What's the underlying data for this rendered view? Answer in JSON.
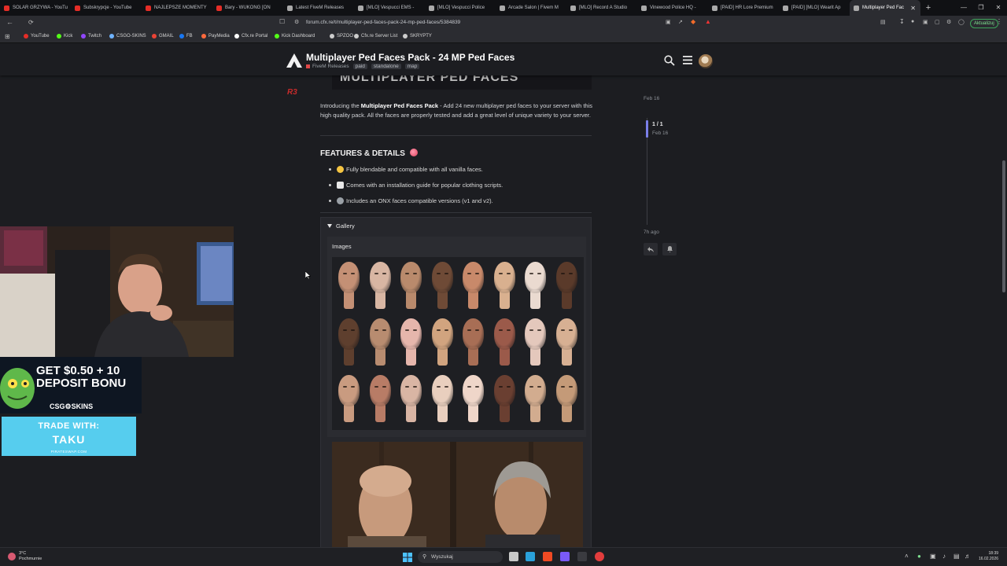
{
  "browser": {
    "tabs": [
      {
        "title": "SOLAR GRZYWA - YouTu",
        "color": "#e52d27"
      },
      {
        "title": "Subskrypcje - YouTube",
        "color": "#e52d27"
      },
      {
        "title": "NAJLEPSZE MOMENTY",
        "color": "#e52d27"
      },
      {
        "title": "Bary - WUKONG [ON",
        "color": "#e52d27"
      },
      {
        "title": "Latest FiveM Releases",
        "color": "#aaaaaa"
      },
      {
        "title": "[MLO] Vespucci EMS -",
        "color": "#aaaaaa"
      },
      {
        "title": "[MLO] Vespucci Police",
        "color": "#aaaaaa"
      },
      {
        "title": "Arcade Salon | Fivem M",
        "color": "#aaaaaa"
      },
      {
        "title": "[MLO] Record A Studio",
        "color": "#aaaaaa"
      },
      {
        "title": "Vinewood Police HQ - ",
        "color": "#aaaaaa"
      },
      {
        "title": "[PAID] HR Lore Premium",
        "color": "#aaaaaa"
      },
      {
        "title": "[PAID] [MLO] Wearit Ap",
        "color": "#aaaaaa"
      },
      {
        "title": "Multiplayer Ped Fac",
        "color": "#aaaaaa",
        "active": true
      }
    ],
    "url": "forum.cfx.re/t/multiplayer-ped-faces-pack-24-mp-ped-faces/5384839",
    "update_label": "Aktualizuj",
    "bookmarks": [
      {
        "label": "YouTube",
        "color": "#e52d27"
      },
      {
        "label": "Kick",
        "color": "#53fc18"
      },
      {
        "label": "Twitch",
        "color": "#9146ff"
      },
      {
        "label": "CSGO-SKINS",
        "color": "#6fb3ff"
      },
      {
        "label": "GMAIL",
        "color": "#ea4335"
      },
      {
        "label": "FB",
        "color": "#1877f2"
      },
      {
        "label": "PayMedia",
        "color": "#ff6a3d"
      },
      {
        "label": "Cfx.re Portal",
        "color": "#ffffff"
      },
      {
        "label": "Kick Dashboard",
        "color": "#53fc18"
      },
      {
        "label": "SPZOO",
        "color": "#cccccc"
      },
      {
        "label": "Cfx.re Server List",
        "color": "#cccccc"
      },
      {
        "label": "SKRYPTY",
        "color": "#cccccc"
      }
    ]
  },
  "header": {
    "title": "Multiplayer Ped Faces Pack - 24 MP Ped Faces",
    "category": "FiveM Releases",
    "tags": [
      "paid",
      "standalone",
      "map"
    ]
  },
  "post": {
    "poster_mark": "R3",
    "banner_text": "MULTIPLAYER PED FACES",
    "intro_prefix": "Introducing the ",
    "intro_bold": "Multiplayer Ped Faces Pack",
    "intro_suffix": " - Add 24 new multiplayer ped faces to your server with this high quality pack. All the faces are properly tested and add a great level of unique variety to your server.",
    "features_heading": "FEATURES & DETAILS",
    "features": [
      {
        "text": "Fully blendable and compatible with all vanilla faces.",
        "icon": "smiley-icon",
        "color": "#f5c542"
      },
      {
        "text": "Comes with an installation guide for popular clothing scripts.",
        "icon": "book-icon",
        "color": "#e8e8e8"
      },
      {
        "text": "Includes an ONX faces compatible versions (v1 and v2).",
        "icon": "gear-icon",
        "color": "#9aa0a6"
      }
    ],
    "gallery_label": "Gallery",
    "images_label": "Images"
  },
  "timeline": {
    "start": "Feb 16",
    "position": "1 / 1",
    "position_date": "Feb 16",
    "end": "7h ago"
  },
  "overlay": {
    "promo_headline": "GET $0.50 + 10 DEPOSIT BONU",
    "promo_brand": "CSG⚙SKINS",
    "trade_line1": "TRADE WITH:",
    "trade_line2": "TAKU",
    "trade_site": "PIRATESWAP.COM"
  },
  "taskbar": {
    "weather_temp": "3°C",
    "weather_desc": "Pochmurnie",
    "search_placeholder": "Wyszukaj",
    "time": "18:39",
    "date": "16.02.2026"
  },
  "colors": {
    "accent": "#7a7fe8",
    "page_bg": "#1c1d21"
  }
}
